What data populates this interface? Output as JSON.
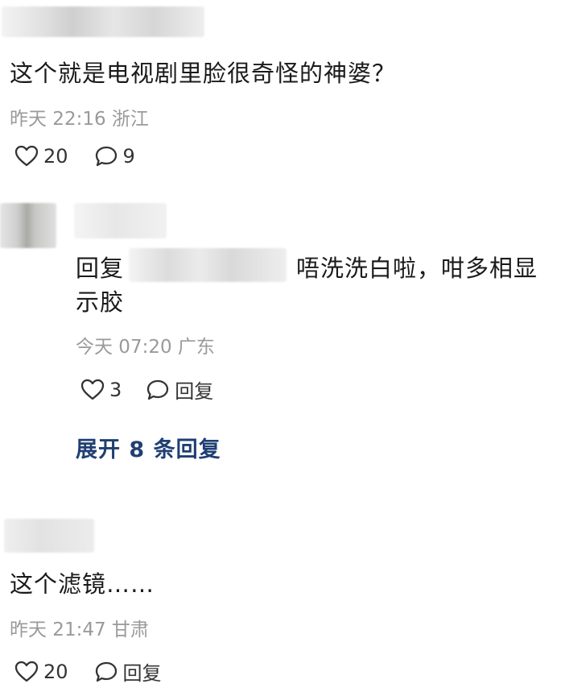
{
  "comments": [
    {
      "text": "这个就是电视剧里脸很奇怪的神婆？",
      "meta": "昨天 22:16 浙江",
      "likes": "20",
      "replies": "9",
      "icons": {
        "like": "heart-icon",
        "comment": "comment-bubble-icon"
      }
    },
    {
      "reply_prefix": "回复",
      "text_line1": "唔洗洗白啦，咁多相显",
      "text_line2": "示胶",
      "meta": "今天 07:20 广东",
      "likes": "3",
      "reply_label": "回复"
    },
    {
      "text": "这个滤镜……",
      "meta": "昨天 21:47 甘肃",
      "likes": "20",
      "reply_label": "回复"
    }
  ],
  "expand_replies": "展开 8 条回复",
  "colors": {
    "text": "#1a1a1a",
    "meta": "#9a9a9a",
    "link": "#1f3f73",
    "icon": "#333333"
  }
}
